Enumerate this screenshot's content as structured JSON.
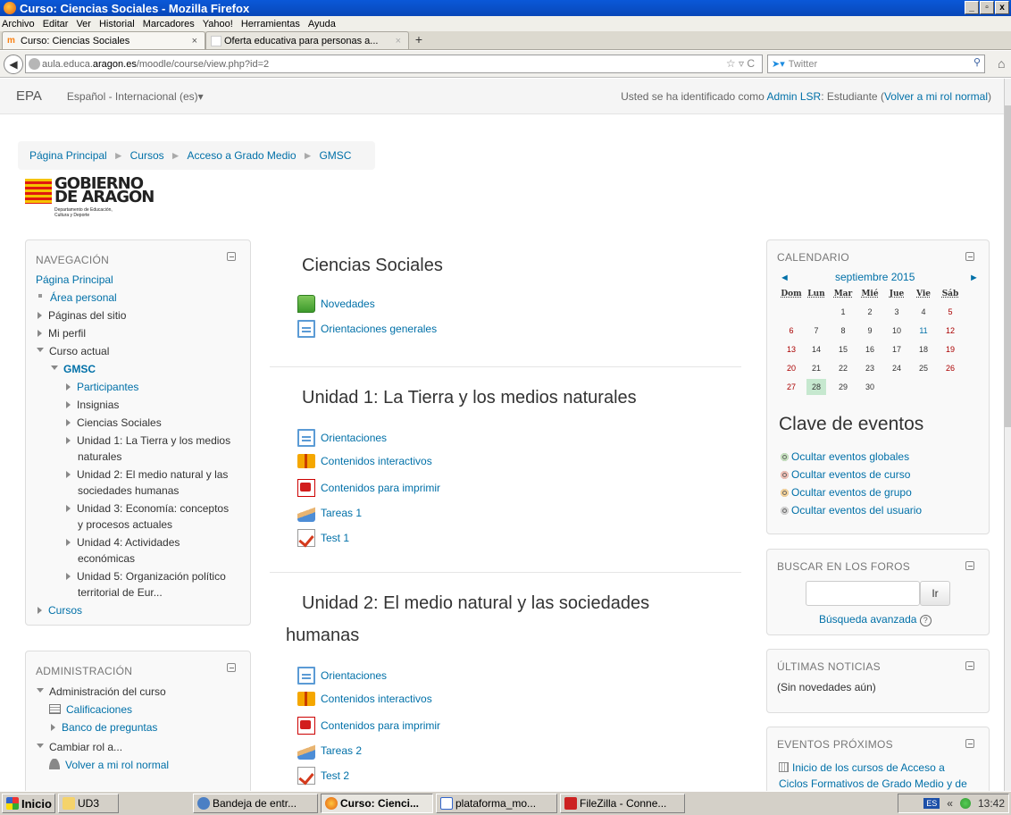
{
  "window": {
    "title": "Curso: Ciencias Sociales - Mozilla Firefox"
  },
  "menu": [
    "Archivo",
    "Editar",
    "Ver",
    "Historial",
    "Marcadores",
    "Yahoo!",
    "Herramientas",
    "Ayuda"
  ],
  "tabs": [
    {
      "label": "Curso: Ciencias Sociales"
    },
    {
      "label": "Oferta educativa para personas a..."
    }
  ],
  "url": {
    "prefix": "aula.educa.",
    "domain": "aragon.es",
    "path": "/moodle/course/view.php?id=2"
  },
  "search_engine": "Twitter",
  "site": {
    "brand": "EPA",
    "language": "Español - Internacional (es)"
  },
  "userinfo": {
    "prefix": "Usted se ha identificado como ",
    "user": "Admin LSR",
    "middle": ": Estudiante (",
    "link": "Volver a mi rol normal",
    "suffix": ")"
  },
  "breadcrumb": [
    "Página Principal",
    "Cursos",
    "Acceso a Grado Medio",
    "GMSC"
  ],
  "logo": {
    "line1": "GOBIERNO",
    "line2": "DE ARAGON",
    "line3": "Departamento de Educación, Cultura y Deporte"
  },
  "navigation": {
    "title": "NAVEGACIÓN",
    "home": "Página Principal",
    "area_personal": "Área personal",
    "paginas_sitio": "Páginas del sitio",
    "mi_perfil": "Mi perfil",
    "curso_actual": "Curso actual",
    "course": "GMSC",
    "participantes": "Participantes",
    "insignias": "Insignias",
    "ciencias": "Ciencias Sociales",
    "u1a": "Unidad 1: La Tierra y los medios",
    "u1b": "naturales",
    "u2a": "Unidad 2: El medio natural y las",
    "u2b": "sociedades humanas",
    "u3a": "Unidad 3: Economía: conceptos",
    "u3b": "y procesos actuales",
    "u4a": "Unidad 4: Actividades",
    "u4b": "económicas",
    "u5a": "Unidad 5: Organización político",
    "u5b": "territorial de Eur...",
    "cursos": "Cursos"
  },
  "admin": {
    "title": "ADMINISTRACIÓN",
    "course_admin": "Administración del curso",
    "calificaciones": "Calificaciones",
    "banco": "Banco de preguntas",
    "cambiar_rol": "Cambiar rol a...",
    "volver": "Volver a mi rol normal"
  },
  "main": {
    "s0": {
      "title": "Ciencias Sociales",
      "a1": "Novedades",
      "a2": "Orientaciones generales"
    },
    "s1": {
      "title": "Unidad 1: La Tierra y los medios naturales",
      "a1": "Orientaciones",
      "a2": "Contenidos interactivos",
      "a3": "Contenidos para imprimir",
      "a4": "Tareas 1",
      "a5": "Test 1"
    },
    "s2": {
      "title1": "Unidad 2: El medio natural y las sociedades",
      "title2": "humanas",
      "a1": "Orientaciones",
      "a2": "Contenidos interactivos",
      "a3": "Contenidos para imprimir",
      "a4": "Tareas 2",
      "a5": "Test 2"
    }
  },
  "calendar": {
    "title": "CALENDARIO",
    "month": "septiembre 2015",
    "days": [
      "Dom",
      "Lun",
      "Mar",
      "Mié",
      "Jue",
      "Vie",
      "Sáb"
    ],
    "weeks": [
      [
        "",
        "",
        "1",
        "2",
        "3",
        "4",
        "5"
      ],
      [
        "6",
        "7",
        "8",
        "9",
        "10",
        "11",
        "12"
      ],
      [
        "13",
        "14",
        "15",
        "16",
        "17",
        "18",
        "19"
      ],
      [
        "20",
        "21",
        "22",
        "23",
        "24",
        "25",
        "26"
      ],
      [
        "27",
        "28",
        "29",
        "30",
        "",
        "",
        ""
      ]
    ],
    "today": "28",
    "event_day": "11"
  },
  "event_key": {
    "title": "Clave de eventos",
    "items": [
      {
        "label": "Ocultar eventos globales",
        "color": "#c7e4c0"
      },
      {
        "label": "Ocultar eventos de curso",
        "color": "#f3c2b8"
      },
      {
        "label": "Ocultar eventos de grupo",
        "color": "#f7d49a"
      },
      {
        "label": "Ocultar eventos del usuario",
        "color": "#d6d6d6"
      }
    ]
  },
  "forum_search": {
    "title": "BUSCAR EN LOS FOROS",
    "button": "Ir",
    "advanced": "Búsqueda avanzada"
  },
  "news": {
    "title": "ÚLTIMAS NOTICIAS",
    "empty": "(Sin novedades aún)"
  },
  "upcoming": {
    "title": "EVENTOS PRÓXIMOS",
    "line1": "Inicio de los cursos de Acceso a",
    "line2": "Ciclos Formativos de Grado Medio y de"
  },
  "taskbar": {
    "start": "Inicio",
    "items": [
      "UD3",
      "Bandeja de entr...",
      "Curso: Cienci...",
      "plataforma_mo...",
      "FileZilla - Conne..."
    ],
    "lang": "ES",
    "time": "13:42"
  }
}
